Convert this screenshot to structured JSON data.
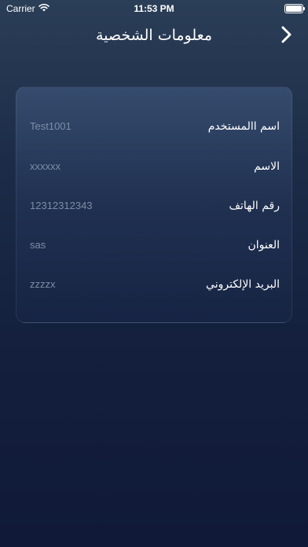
{
  "status_bar": {
    "carrier": "Carrier",
    "time": "11:53 PM",
    "battery_level": 1.0
  },
  "nav": {
    "title": "معلومات الشخصية",
    "back_icon": "chevron-right-icon"
  },
  "profile": {
    "fields": [
      {
        "label": "اسم االمستخدم",
        "value": "Test1001"
      },
      {
        "label": "الاسم",
        "value": "xxxxxx"
      },
      {
        "label": "رقم الهاتف",
        "value": "12312312343"
      },
      {
        "label": "العنوان",
        "value": "sas"
      },
      {
        "label": "البريد الإلكتروني",
        "value": "zzzzx"
      }
    ]
  },
  "colors": {
    "background_top": "#2b3e57",
    "background_bottom": "#101a38",
    "value_text": "#7d8da6"
  }
}
